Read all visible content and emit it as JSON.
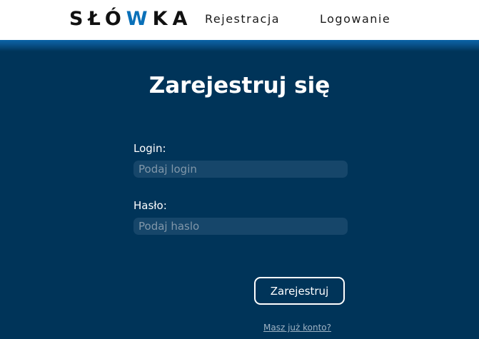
{
  "header": {
    "logo": {
      "part1": "SŁÓ",
      "accent": "W",
      "part2": "KA"
    },
    "nav": {
      "register": "Rejestracja",
      "login": "Logowanie"
    }
  },
  "main": {
    "title": "Zarejestruj się",
    "login": {
      "label": "Login:",
      "placeholder": "Podaj login",
      "value": ""
    },
    "password": {
      "label": "Hasło:",
      "placeholder": "Podaj haslo",
      "value": ""
    },
    "submit_label": "Zarejestruj",
    "account_link": "Masz już konto?"
  },
  "colors": {
    "background": "#003459",
    "logo_accent": "#0a70b8",
    "input_bg": "#16466a"
  }
}
